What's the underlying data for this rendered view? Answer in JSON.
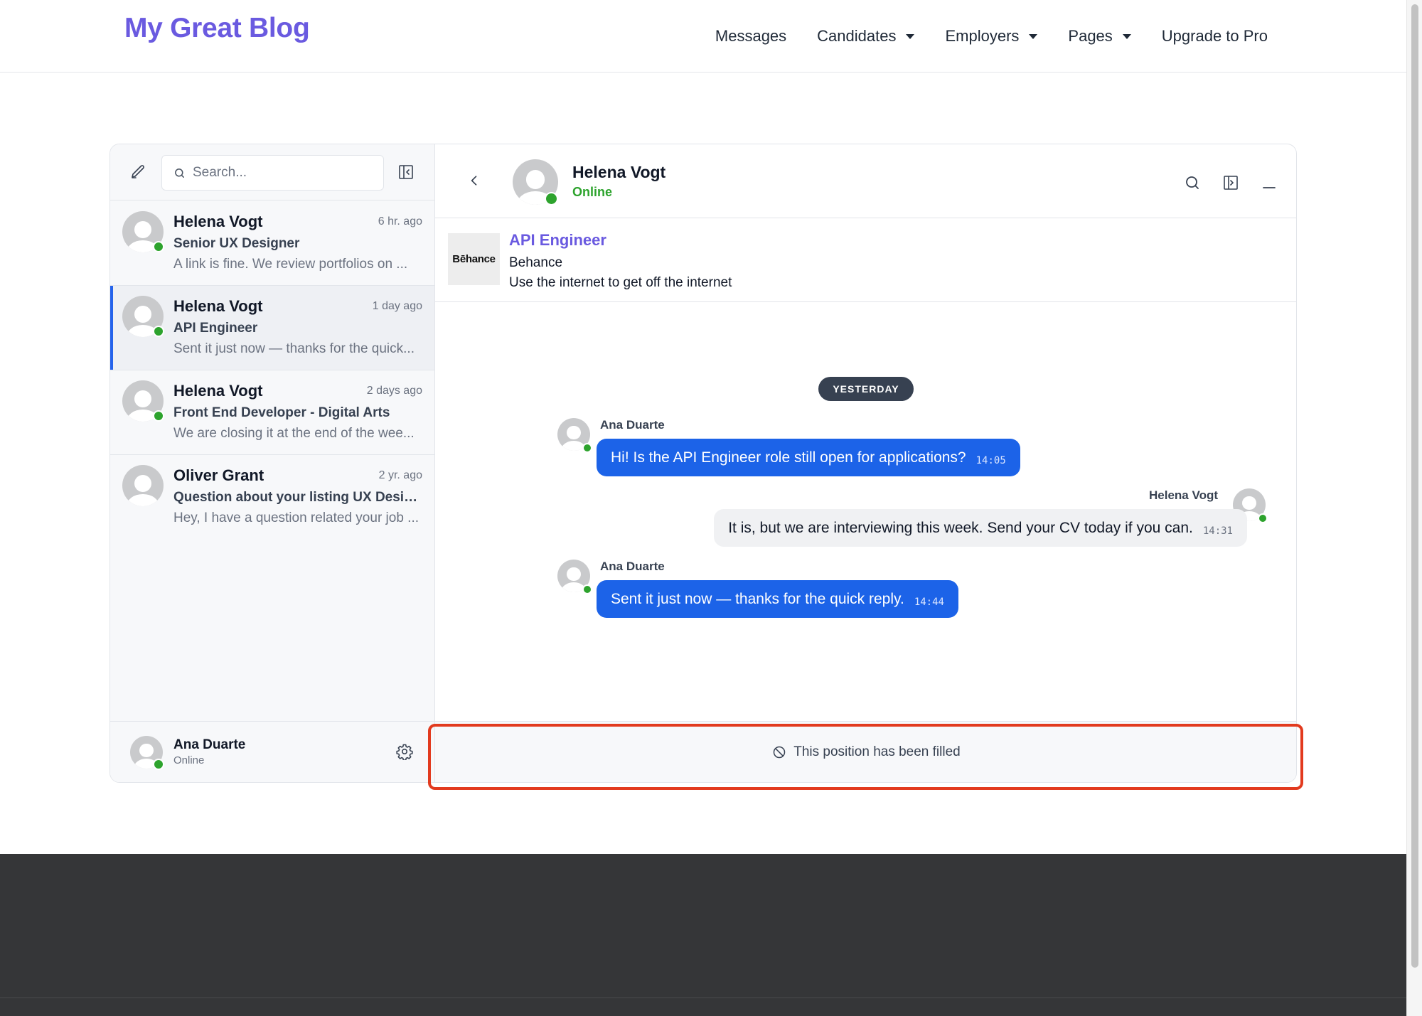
{
  "site": {
    "logo": "My Great Blog",
    "nav": [
      {
        "label": "Messages",
        "dropdown": false
      },
      {
        "label": "Candidates",
        "dropdown": true
      },
      {
        "label": "Employers",
        "dropdown": true
      },
      {
        "label": "Pages",
        "dropdown": true
      },
      {
        "label": "Upgrade to Pro",
        "dropdown": false
      }
    ]
  },
  "sidebar": {
    "search_placeholder": "Search...",
    "conversations": [
      {
        "name": "Helena Vogt",
        "time": "6 hr. ago",
        "subject": "Senior UX Designer",
        "preview": "A link is fine. We review portfolios on ...",
        "online": true,
        "active": false
      },
      {
        "name": "Helena Vogt",
        "time": "1 day ago",
        "subject": "API Engineer",
        "preview": "Sent it just now — thanks for the quick...",
        "online": true,
        "active": true
      },
      {
        "name": "Helena Vogt",
        "time": "2 days ago",
        "subject": "Front End Developer - Digital Arts",
        "preview": "We are closing it at the end of the wee...",
        "online": true,
        "active": false
      },
      {
        "name": "Oliver Grant",
        "time": "2 yr. ago",
        "subject": "Question about your listing UX Desig...",
        "preview": "Hey, I have a question related your job ...",
        "online": false,
        "active": false
      }
    ],
    "me": {
      "name": "Ana Duarte",
      "status": "Online"
    }
  },
  "chat": {
    "peer": {
      "name": "Helena Vogt",
      "status": "Online"
    },
    "job": {
      "title": "API Engineer",
      "company": "Behance",
      "tagline": "Use the internet to get off the internet",
      "logo_text": "Bēhance"
    },
    "day_separator": "YESTERDAY",
    "messages": [
      {
        "sender": "Ana Duarte",
        "text": "Hi! Is the API Engineer role still open for applications?",
        "time": "14:05",
        "direction": "out"
      },
      {
        "sender": "Helena Vogt",
        "text": "It is, but we are interviewing this week. Send your CV today if you can.",
        "time": "14:31",
        "direction": "in"
      },
      {
        "sender": "Ana Duarte",
        "text": "Sent it just now — thanks for the quick reply.",
        "time": "14:44",
        "direction": "out"
      }
    ],
    "closed_notice": "This position has been filled"
  },
  "colors": {
    "brand": "#6a5ae0",
    "accent_blue": "#1c63e8",
    "online_green": "#2da32d",
    "highlight_red": "#e23a1e",
    "footer": "#353638"
  }
}
